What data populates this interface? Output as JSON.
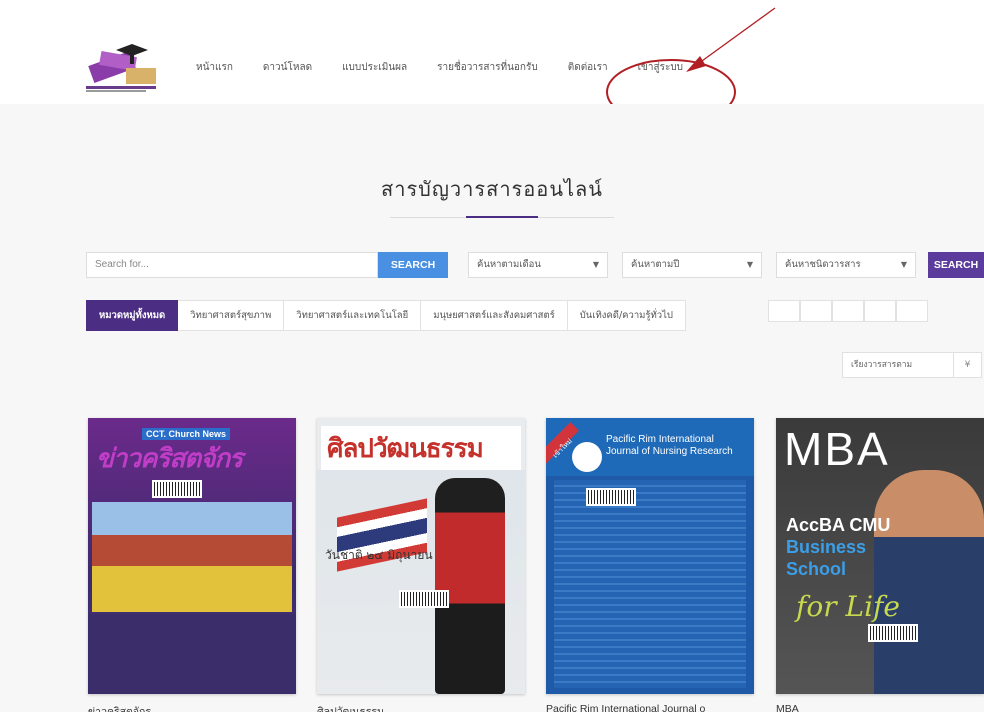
{
  "header": {
    "logo_alt": "logo",
    "nav": [
      {
        "label": "หน้าแรก"
      },
      {
        "label": "ดาวน์โหลด"
      },
      {
        "label": "แบบประเมินผล"
      },
      {
        "label": "รายชื่อวารสารที่นอกรับ"
      },
      {
        "label": "ติดต่อเรา"
      },
      {
        "label": "เข้าสู่ระบบ"
      }
    ]
  },
  "annotation": {
    "arrow_color": "#b11f24",
    "ellipse_color": "#b11f24"
  },
  "main": {
    "title": "สารบัญวารสารออนไลน์"
  },
  "search": {
    "placeholder": "Search for...",
    "button_label": "SEARCH",
    "month_select": "ค้นหาตามเดือน",
    "year_select": "ค้นหาตามปี",
    "type_select": "ค้นหาชนิดวารสาร",
    "button2_label": "SEARCH"
  },
  "tabs": [
    {
      "label": "หมวดหมู่ทั้งหมด",
      "active": true
    },
    {
      "label": "วิทยาศาสตร์สุขภาพ"
    },
    {
      "label": "วิทยาศาสตร์และเทคโนโลยี"
    },
    {
      "label": "มนุษยศาสตร์และสังคมศาสตร์"
    },
    {
      "label": "บันเทิงคดี/ความรู้ทั่วไป"
    }
  ],
  "sort": {
    "label": "เรียงวารสารตาม",
    "caret": "¥"
  },
  "cards": [
    {
      "caption": "ข่าวคริสตจักร",
      "cover_title": "ข่าวคริสตจักร",
      "cover_band": "CCT. Church News"
    },
    {
      "caption": "ศิลปวัฒนธรรม",
      "cover_title": "ศิลปวัฒนธรรม",
      "cover_text": "วันชาติ ๒๔ มิถุนายน"
    },
    {
      "caption": "Pacific Rim International Journal o",
      "cover_title": "Pacific Rim International Journal of Nursing Research",
      "ribbon": "เข้าใหม่"
    },
    {
      "caption": "MBA",
      "cover_title": "MBA",
      "cover_line1": "AccBA CMU",
      "cover_line2": "Business",
      "cover_line3": "School",
      "cover_life": "for Life"
    }
  ],
  "colors": {
    "accent": "#4b2e83",
    "search_button": "#4a90e2"
  }
}
